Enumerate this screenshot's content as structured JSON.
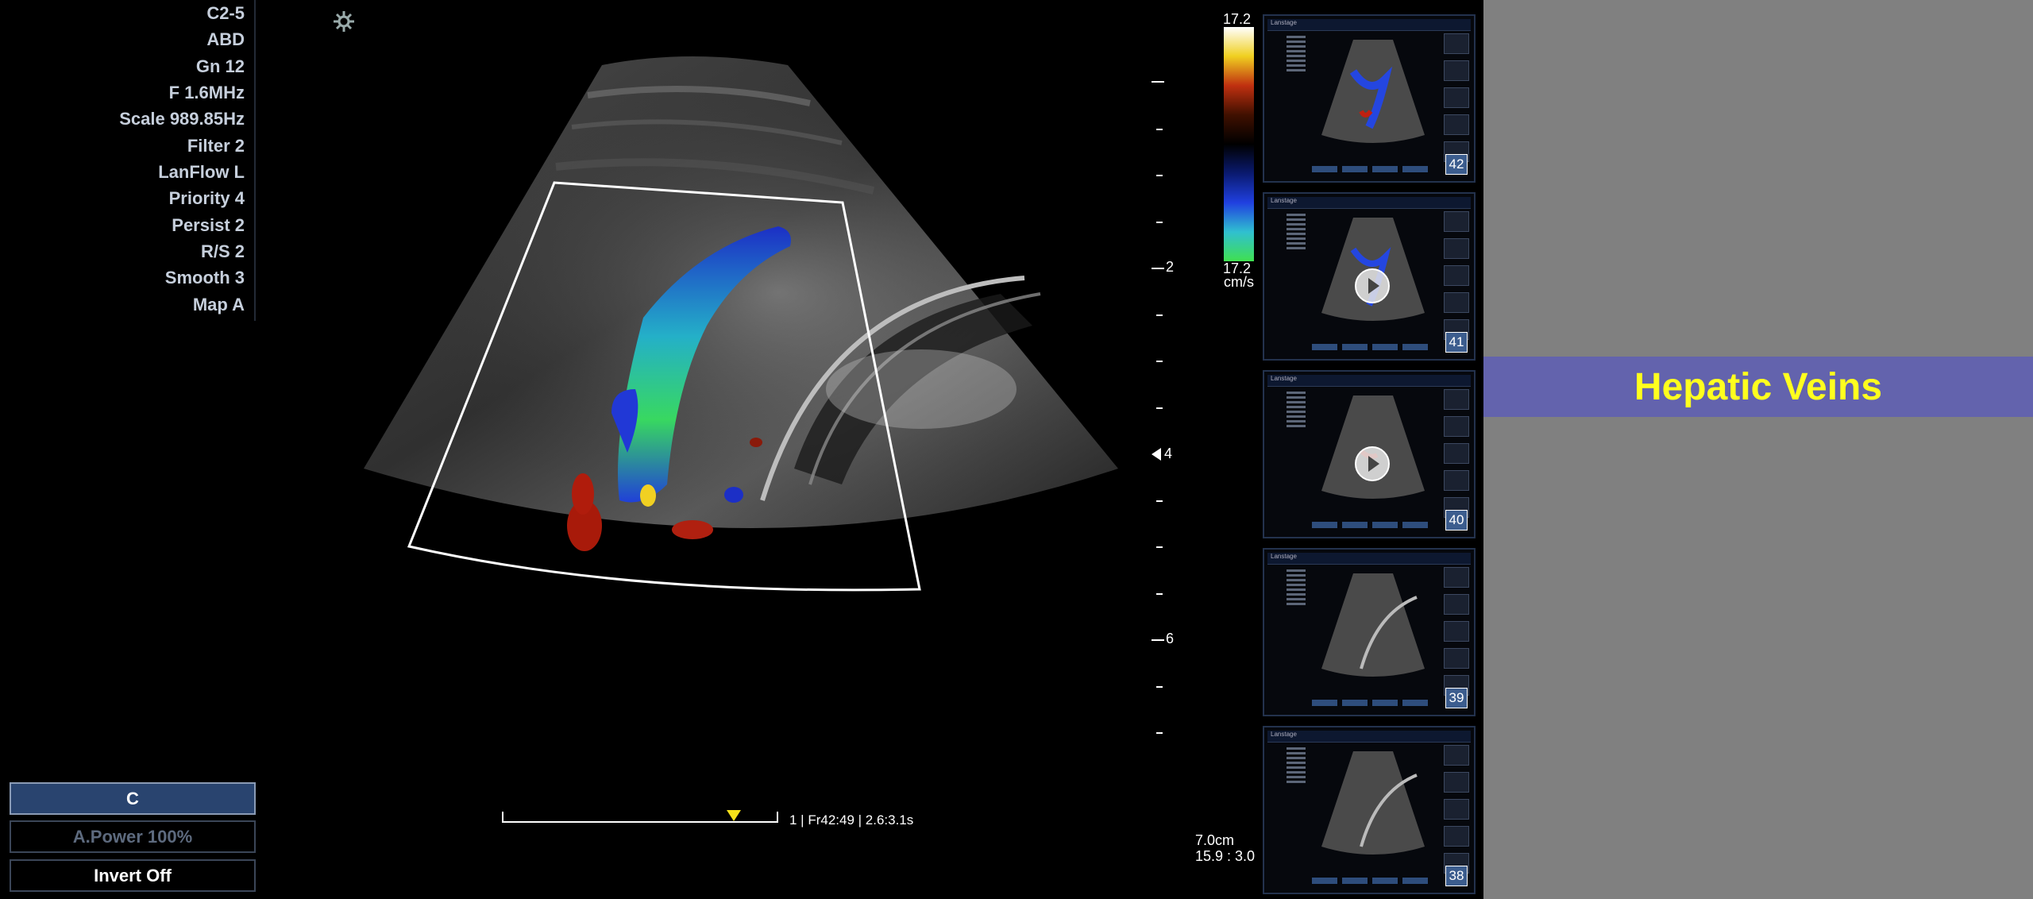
{
  "params": [
    "C2-5",
    "ABD",
    "Gn 12",
    "F 1.6MHz",
    "Scale 989.85Hz",
    "Filter 2",
    "LanFlow L",
    "Priority 4",
    "Persist 2",
    "R/S 2",
    "Smooth 3",
    "Map A"
  ],
  "controls": {
    "c_label": "C",
    "apower_label": "A.Power 100%",
    "invert_label": "Invert  Off"
  },
  "depth_labels": [
    "2",
    "4",
    "6"
  ],
  "colorbar": {
    "top": "17.2",
    "bottom": "17.2",
    "unit": "cm/s",
    "colors": [
      "#ffffff",
      "#f0d020",
      "#c03010",
      "#401000",
      "#000000",
      "#0a1a70",
      "#2040e0",
      "#30c0d0",
      "#40e050"
    ]
  },
  "cine": {
    "info": "1 | Fr42:49 | 2.6:3.1s",
    "position": 0.84
  },
  "readout": {
    "depth": "7.0cm",
    "ratio": "15.9 : 3.0"
  },
  "thumbnails": [
    {
      "number": "42",
      "play": false,
      "color": true
    },
    {
      "number": "41",
      "play": true,
      "color": true
    },
    {
      "number": "40",
      "play": true,
      "color": true
    },
    {
      "number": "39",
      "play": false,
      "color": false
    },
    {
      "number": "38",
      "play": false,
      "color": false
    }
  ],
  "thumb_header": "Lanstage",
  "banner_title": "Hepatic Veins",
  "icons": {
    "settings": "settings-gear-icon",
    "play": "play-icon"
  }
}
